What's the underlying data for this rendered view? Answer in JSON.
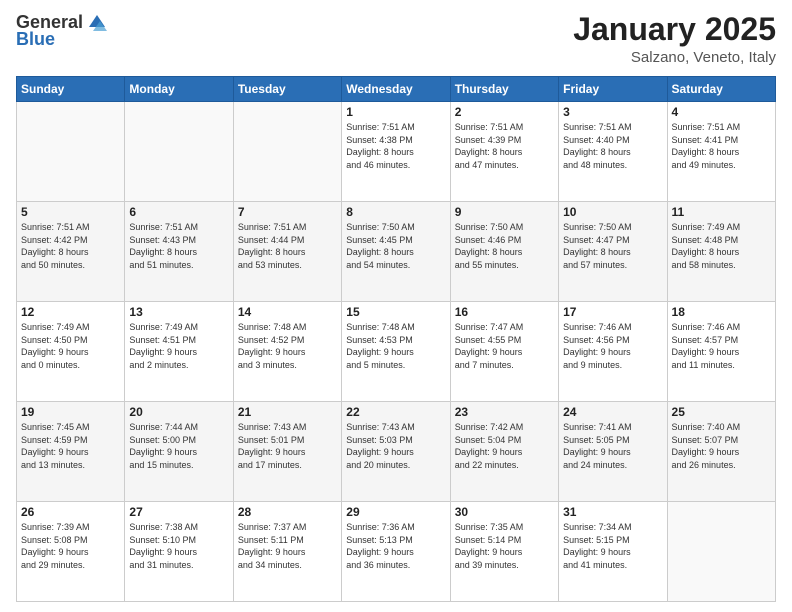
{
  "header": {
    "logo_general": "General",
    "logo_blue": "Blue",
    "month_title": "January 2025",
    "location": "Salzano, Veneto, Italy"
  },
  "days_of_week": [
    "Sunday",
    "Monday",
    "Tuesday",
    "Wednesday",
    "Thursday",
    "Friday",
    "Saturday"
  ],
  "weeks": [
    [
      {
        "day": "",
        "info": ""
      },
      {
        "day": "",
        "info": ""
      },
      {
        "day": "",
        "info": ""
      },
      {
        "day": "1",
        "info": "Sunrise: 7:51 AM\nSunset: 4:38 PM\nDaylight: 8 hours\nand 46 minutes."
      },
      {
        "day": "2",
        "info": "Sunrise: 7:51 AM\nSunset: 4:39 PM\nDaylight: 8 hours\nand 47 minutes."
      },
      {
        "day": "3",
        "info": "Sunrise: 7:51 AM\nSunset: 4:40 PM\nDaylight: 8 hours\nand 48 minutes."
      },
      {
        "day": "4",
        "info": "Sunrise: 7:51 AM\nSunset: 4:41 PM\nDaylight: 8 hours\nand 49 minutes."
      }
    ],
    [
      {
        "day": "5",
        "info": "Sunrise: 7:51 AM\nSunset: 4:42 PM\nDaylight: 8 hours\nand 50 minutes."
      },
      {
        "day": "6",
        "info": "Sunrise: 7:51 AM\nSunset: 4:43 PM\nDaylight: 8 hours\nand 51 minutes."
      },
      {
        "day": "7",
        "info": "Sunrise: 7:51 AM\nSunset: 4:44 PM\nDaylight: 8 hours\nand 53 minutes."
      },
      {
        "day": "8",
        "info": "Sunrise: 7:50 AM\nSunset: 4:45 PM\nDaylight: 8 hours\nand 54 minutes."
      },
      {
        "day": "9",
        "info": "Sunrise: 7:50 AM\nSunset: 4:46 PM\nDaylight: 8 hours\nand 55 minutes."
      },
      {
        "day": "10",
        "info": "Sunrise: 7:50 AM\nSunset: 4:47 PM\nDaylight: 8 hours\nand 57 minutes."
      },
      {
        "day": "11",
        "info": "Sunrise: 7:49 AM\nSunset: 4:48 PM\nDaylight: 8 hours\nand 58 minutes."
      }
    ],
    [
      {
        "day": "12",
        "info": "Sunrise: 7:49 AM\nSunset: 4:50 PM\nDaylight: 9 hours\nand 0 minutes."
      },
      {
        "day": "13",
        "info": "Sunrise: 7:49 AM\nSunset: 4:51 PM\nDaylight: 9 hours\nand 2 minutes."
      },
      {
        "day": "14",
        "info": "Sunrise: 7:48 AM\nSunset: 4:52 PM\nDaylight: 9 hours\nand 3 minutes."
      },
      {
        "day": "15",
        "info": "Sunrise: 7:48 AM\nSunset: 4:53 PM\nDaylight: 9 hours\nand 5 minutes."
      },
      {
        "day": "16",
        "info": "Sunrise: 7:47 AM\nSunset: 4:55 PM\nDaylight: 9 hours\nand 7 minutes."
      },
      {
        "day": "17",
        "info": "Sunrise: 7:46 AM\nSunset: 4:56 PM\nDaylight: 9 hours\nand 9 minutes."
      },
      {
        "day": "18",
        "info": "Sunrise: 7:46 AM\nSunset: 4:57 PM\nDaylight: 9 hours\nand 11 minutes."
      }
    ],
    [
      {
        "day": "19",
        "info": "Sunrise: 7:45 AM\nSunset: 4:59 PM\nDaylight: 9 hours\nand 13 minutes."
      },
      {
        "day": "20",
        "info": "Sunrise: 7:44 AM\nSunset: 5:00 PM\nDaylight: 9 hours\nand 15 minutes."
      },
      {
        "day": "21",
        "info": "Sunrise: 7:43 AM\nSunset: 5:01 PM\nDaylight: 9 hours\nand 17 minutes."
      },
      {
        "day": "22",
        "info": "Sunrise: 7:43 AM\nSunset: 5:03 PM\nDaylight: 9 hours\nand 20 minutes."
      },
      {
        "day": "23",
        "info": "Sunrise: 7:42 AM\nSunset: 5:04 PM\nDaylight: 9 hours\nand 22 minutes."
      },
      {
        "day": "24",
        "info": "Sunrise: 7:41 AM\nSunset: 5:05 PM\nDaylight: 9 hours\nand 24 minutes."
      },
      {
        "day": "25",
        "info": "Sunrise: 7:40 AM\nSunset: 5:07 PM\nDaylight: 9 hours\nand 26 minutes."
      }
    ],
    [
      {
        "day": "26",
        "info": "Sunrise: 7:39 AM\nSunset: 5:08 PM\nDaylight: 9 hours\nand 29 minutes."
      },
      {
        "day": "27",
        "info": "Sunrise: 7:38 AM\nSunset: 5:10 PM\nDaylight: 9 hours\nand 31 minutes."
      },
      {
        "day": "28",
        "info": "Sunrise: 7:37 AM\nSunset: 5:11 PM\nDaylight: 9 hours\nand 34 minutes."
      },
      {
        "day": "29",
        "info": "Sunrise: 7:36 AM\nSunset: 5:13 PM\nDaylight: 9 hours\nand 36 minutes."
      },
      {
        "day": "30",
        "info": "Sunrise: 7:35 AM\nSunset: 5:14 PM\nDaylight: 9 hours\nand 39 minutes."
      },
      {
        "day": "31",
        "info": "Sunrise: 7:34 AM\nSunset: 5:15 PM\nDaylight: 9 hours\nand 41 minutes."
      },
      {
        "day": "",
        "info": ""
      }
    ]
  ]
}
